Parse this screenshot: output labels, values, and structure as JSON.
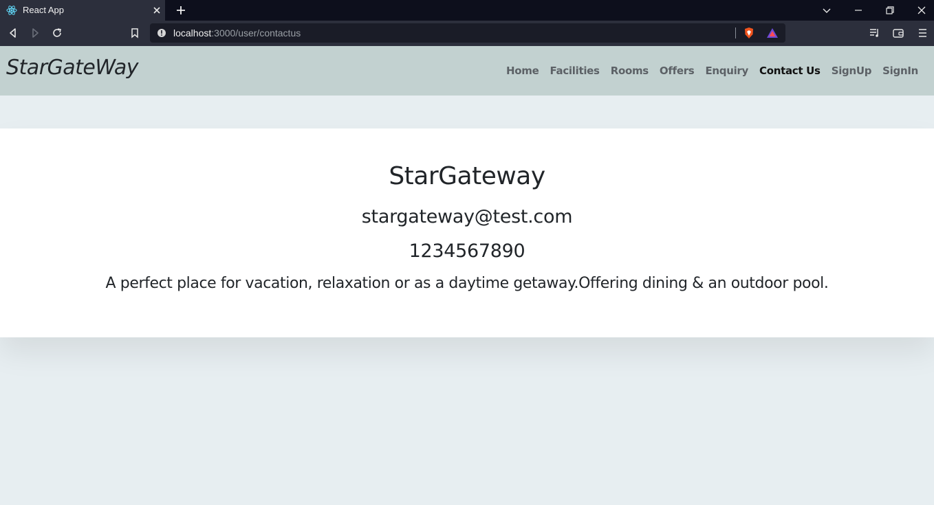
{
  "browser": {
    "tab": {
      "title": "React App",
      "favicon": "react-icon"
    },
    "address": {
      "host": "localhost",
      "path": ":3000/user/contactus"
    },
    "colors": {
      "tabbar": "#0d0f1c",
      "toolbar": "#2c2f3c"
    }
  },
  "navbar": {
    "brand": "StarGateWay",
    "links": [
      {
        "label": "Home"
      },
      {
        "label": "Facilities"
      },
      {
        "label": "Rooms"
      },
      {
        "label": "Offers"
      },
      {
        "label": "Enquiry"
      },
      {
        "label": "Contact Us",
        "active": true
      },
      {
        "label": "SignUp"
      },
      {
        "label": "SignIn"
      }
    ],
    "background": "#c2d1d0"
  },
  "contact": {
    "name": "StarGateway",
    "email": "stargateway@test.com",
    "phone": "1234567890",
    "description": "A perfect place for vacation, relaxation or as a daytime getaway.Offering dining & an outdoor pool."
  },
  "page": {
    "background": "#e7eef1"
  }
}
